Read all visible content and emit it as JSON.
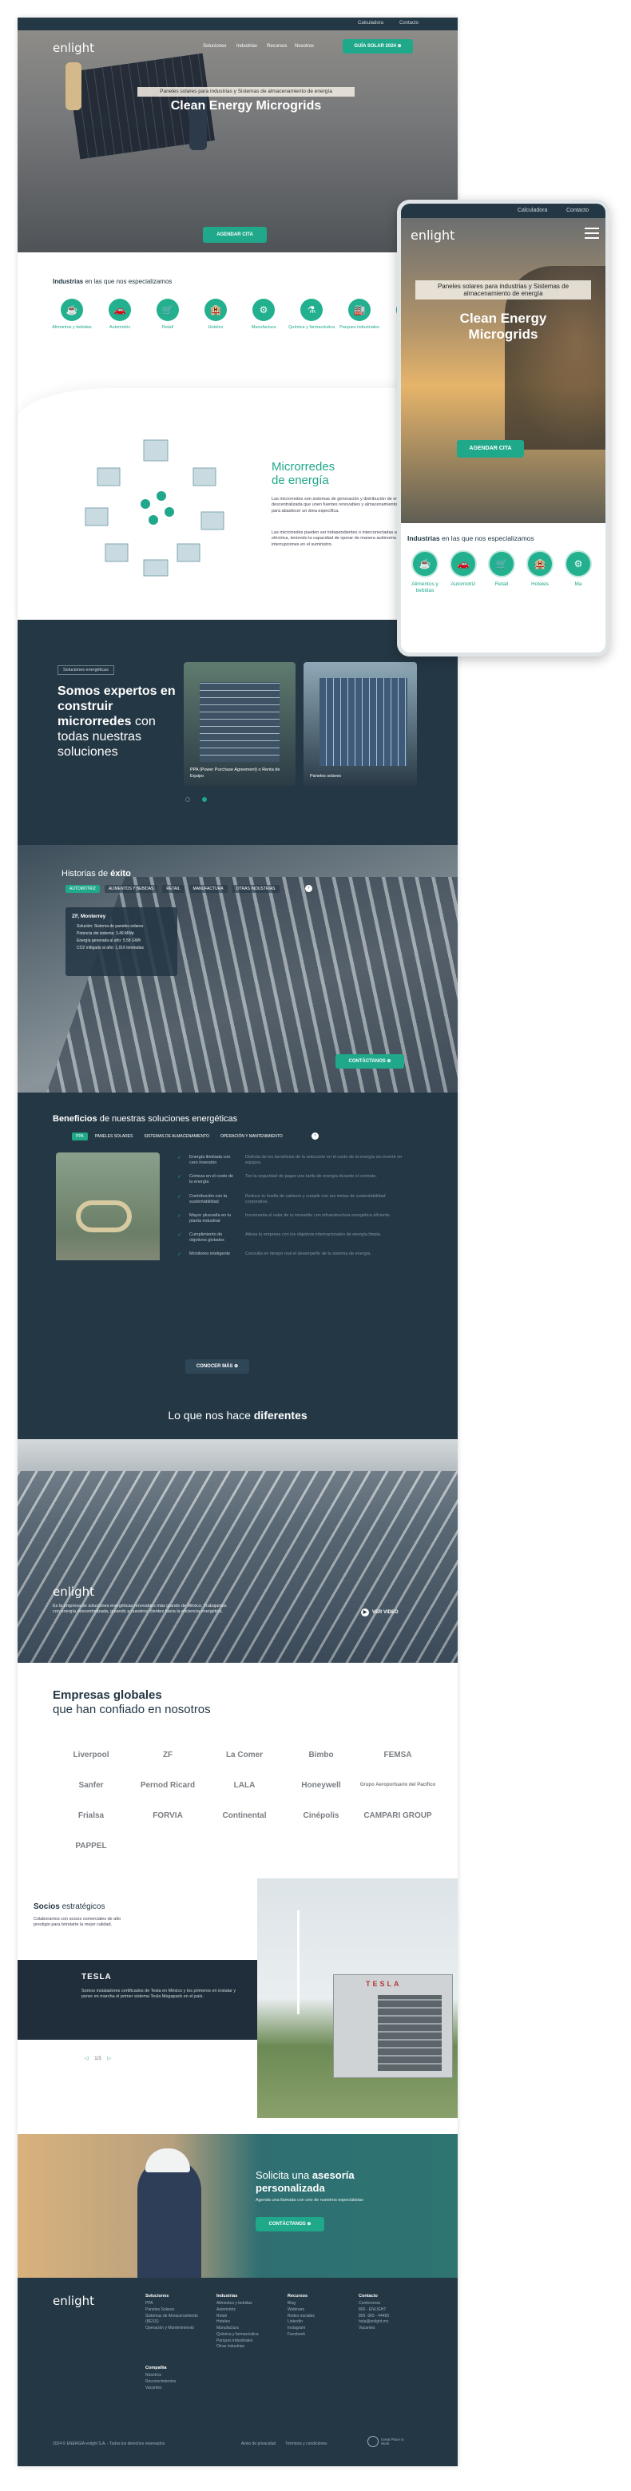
{
  "nav": {
    "top_links": [
      "Calculadora",
      "Contacto"
    ],
    "logo": "enlight",
    "links": [
      "Soluciones",
      "Industrias",
      "Recursos",
      "Nosotros"
    ],
    "cta": "GUÍA SOLAR 2024"
  },
  "hero": {
    "kicker": "Paneles solares para industrias y Sistemas de almacenamiento de energía",
    "title": "Clean Energy Microgrids",
    "cta": "AGENDAR CITA"
  },
  "industries": {
    "title_bold": "Industrias",
    "title_rest": " en las que nos especializamos",
    "items": [
      "Alimentos y bebidas",
      "Automotriz",
      "Retail",
      "Hoteles",
      "Manufactura",
      "Química y farmacéutica",
      "Parques industriales",
      "Otros"
    ]
  },
  "microgrid": {
    "title_line1": "Microrredes",
    "title_line2": "de energía",
    "p1": "Las microrredes son sistemas de generación y distribución de energía descentralizada que unen fuentes renovables y almacenamiento de energía para abastecer un área específica.",
    "p2": "Las microrredes pueden ser independientes o interconectadas a la red eléctrica, teniendo la capacidad de operar de manera autónoma en interrupciones en el suministro."
  },
  "experts": {
    "badge": "Soluciones energéticas",
    "title_bold": "Somos expertos en construir microrredes",
    "title_rest": " con todas nuestras soluciones",
    "cards": [
      "PPA (Power Purchase Agreement) o Renta de Equipo",
      "Paneles solares"
    ]
  },
  "success": {
    "title_light": "Historias de ",
    "title_bold": "éxito",
    "tabs": [
      "AUTOMOTRIZ",
      "ALIMENTOS Y BEBIDAS",
      "RETAIL",
      "MANUFACTURA",
      "OTRAS INDUSTRIAS"
    ],
    "pin": "ZF, Monterrey",
    "bullets": [
      "Solución: Sistema de paneles solares",
      "Potencia del sistema: 3,49 MWp",
      "Energía generada al año: 5.58 GWh",
      "CO2 mitigado al año: 1,916 toneladas"
    ],
    "cta": "CONTÁCTANOS"
  },
  "benefits": {
    "title_bold": "Beneficios",
    "title_rest": " de nuestras soluciones energéticas",
    "tabs": [
      "PPA",
      "PANELES SOLARES",
      "SISTEMAS DE ALMACENAMIENTO",
      "OPERACIÓN Y MANTENIMIENTO"
    ],
    "rows": [
      {
        "name": "Energía ilimitada con cero inversión",
        "desc": "Disfruta de los beneficios de la reducción en el costo de la energía sin invertir en equipos."
      },
      {
        "name": "Certeza en el costo de la energía",
        "desc": "Ten la seguridad de pagar una tarifa de energía durante el contrato."
      },
      {
        "name": "Contribución con la sustentabilidad",
        "desc": "Reduce tu huella de carbono y cumple con tus metas de sustentabilidad corporativa."
      },
      {
        "name": "Mayor plusvalía en tu planta industrial",
        "desc": "Incrementa el valor de tu inmueble con infraestructura energética eficiente."
      },
      {
        "name": "Cumplimiento de objetivos globales",
        "desc": "Alinea tu empresa con los objetivos internacionales de energía limpia."
      },
      {
        "name": "Monitoreo inteligente",
        "desc": "Consulta en tiempo real el desempeño de tu sistema de energía."
      }
    ],
    "cta": "CONOCER MÁS"
  },
  "different": {
    "title_light": "Lo que nos hace ",
    "title_bold": "diferentes",
    "logo": "enlight",
    "text": "Es la empresa de soluciones energéticas renovables más grande de México. Trabajamos con energía descentralizada, guiando a nuestros clientes hacia la eficiencia energética.",
    "cta": "VER VIDEO"
  },
  "clients": {
    "title_line1": "Empresas globales",
    "title_line2": "que han confiado en nosotros",
    "logos": [
      "Liverpool",
      "ZF",
      "La Comer",
      "Bimbo",
      "FEMSA",
      "Sanfer",
      "Pernod Ricard",
      "LALA",
      "Honeywell",
      "Grupo Aeroportuario del Pacífico",
      "Frialsa",
      "FORVIA",
      "Continental",
      "Cinépolis",
      "CAMPARI GROUP",
      "PAPPEL"
    ]
  },
  "partners": {
    "title_bold": "Socios",
    "title_rest": " estratégicos",
    "text": "Colaboramos con socios comerciales de alto prestigio para brindarte la mejor calidad.",
    "card_title": "TESLA",
    "card_text": "Somos instaladores certificados de Tesla en México y los primeros en instalar y poner en marcha el primer sistema Tesla Megapack en el país.",
    "pager": "1/3",
    "brand": "TESLA"
  },
  "advice": {
    "title_light": "Solicita una ",
    "title_bold": "asesoría personalizada",
    "sub": "Agenda una llamada con uno de nuestros especialistas",
    "cta": "CONTÁCTANOS"
  },
  "footer": {
    "logo": "enlight",
    "cols": [
      {
        "title": "Soluciones",
        "items": [
          "PPA",
          "Paneles Solares",
          "Sistemas de Almacenamiento (BESS)",
          "Operación y Mantenimiento"
        ]
      },
      {
        "title": "Industrias",
        "items": [
          "Alimentos y bebidas",
          "Automotriz",
          "Retail",
          "Hoteles",
          "Manufactura",
          "Química y farmacéutica",
          "Parques industriales",
          "Otras industrias"
        ]
      },
      {
        "title": "Recursos",
        "items": [
          "Blog",
          "Webinars",
          "Redes sociales",
          "LinkedIn",
          "Instagram",
          "Facebook"
        ]
      },
      {
        "title": "Contacto",
        "items": [
          "Conferencia",
          "800 - ENLIGHT",
          "800 -365 - 44483",
          "hola@enlight.mx",
          "Vacantes"
        ]
      }
    ],
    "col2_title": "Compañía",
    "col2_items": [
      "Nosotros",
      "Reconocimientos",
      "Vacantes"
    ],
    "copyright": "2024 © ENERGÍA enlight S.A. - Todos los derechos reservados",
    "legal": [
      "Aviso de privacidad",
      "Términos y condiciones"
    ],
    "badge": "Great Place to Work"
  },
  "mobile": {
    "top_links": [
      "Calculadora",
      "Contacto"
    ],
    "logo": "enlight",
    "kicker": "Paneles solares para industrias y Sistemas de almacenamiento de energía",
    "title": "Clean Energy Microgrids",
    "cta": "AGENDAR CITA",
    "ind_title_bold": "Industrias",
    "ind_title_rest": " en las que nos especializamos",
    "ind_items": [
      "Alimentos y bebidas",
      "Automotriz",
      "Retail",
      "Hoteles",
      "Ma"
    ]
  }
}
